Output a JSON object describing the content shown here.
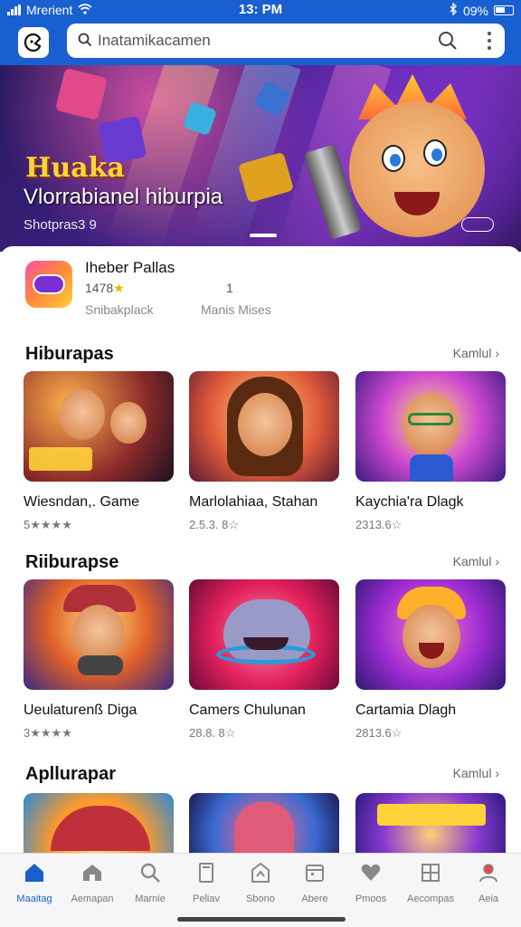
{
  "status_bar": {
    "carrier": "Mrerient",
    "time": "13: PM",
    "battery": "09%"
  },
  "header": {
    "search_placeholder": "Inatamikacamen"
  },
  "banner": {
    "title": "Huaka",
    "subtitle": "Vlorrabianel hiburpia",
    "caption": "Shotpras3 9"
  },
  "featured": {
    "name": "Iheber Pallas",
    "rating": "1478",
    "count": "1",
    "developer": "Snibakplack",
    "meta": "Manis Mises"
  },
  "sections": [
    {
      "title": "Hiburapas",
      "more_label": "Kamlul",
      "items": [
        {
          "title": "Wiesndan,. Game",
          "rating": "5★★★★"
        },
        {
          "title": "Marlolahiaa, Stahan",
          "rating": "2.5.3. 8☆"
        },
        {
          "title": "Kaychia'ra Dlagk",
          "rating": "2313.6☆"
        }
      ]
    },
    {
      "title": "Riiburapse",
      "more_label": "Kamlul",
      "items": [
        {
          "title": "Ueulaturenß Diga",
          "rating": "3★★★★"
        },
        {
          "title": "Camers Chulunan",
          "rating": "28.8. 8☆"
        },
        {
          "title": "Cartamia Dlagh",
          "rating": "2813.6☆"
        }
      ]
    },
    {
      "title": "Aplluraрar",
      "more_label": "Kamlul"
    }
  ],
  "bottom_nav": [
    {
      "label": "Maaitag",
      "icon": "home-icon"
    },
    {
      "label": "Aemapan",
      "icon": "store-icon"
    },
    {
      "label": "Marnie",
      "icon": "search-icon"
    },
    {
      "label": "Peliav",
      "icon": "book-icon"
    },
    {
      "label": "Sbono",
      "icon": "bag-icon"
    },
    {
      "label": "Abere",
      "icon": "calendar-icon"
    },
    {
      "label": "Pmoos",
      "icon": "heart-icon"
    },
    {
      "label": "Aecompas",
      "icon": "grid-icon"
    },
    {
      "label": "Aeia",
      "icon": "profile-icon"
    }
  ],
  "colors": {
    "brand": "#1a5fd0",
    "active_nav": "#1a5fd0"
  }
}
